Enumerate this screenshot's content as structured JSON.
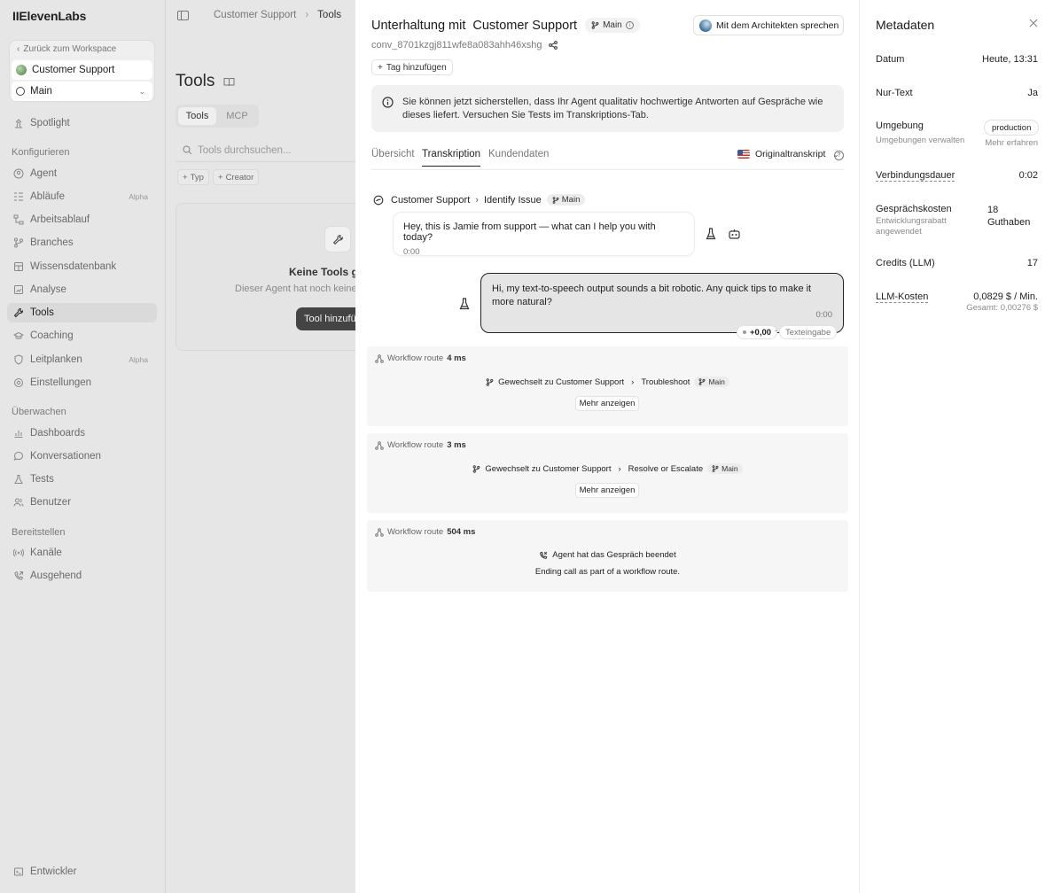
{
  "sidebar": {
    "logo": "IIElevenLabs",
    "back_label": "Zurück zum Workspace",
    "agent_name": "Customer Support",
    "branch": "Main",
    "spotlight": "Spotlight",
    "section_configure": "Konfigurieren",
    "configure_items": [
      {
        "label": "Agent",
        "icon": "agent-icon"
      },
      {
        "label": "Abläufe",
        "icon": "flows-icon",
        "badge": "Alpha"
      },
      {
        "label": "Arbeitsablauf",
        "icon": "workflow-icon"
      },
      {
        "label": "Branches",
        "icon": "branch-icon"
      },
      {
        "label": "Wissensdatenbank",
        "icon": "book-icon"
      },
      {
        "label": "Analyse",
        "icon": "analysis-icon"
      },
      {
        "label": "Tools",
        "icon": "wrench-icon",
        "active": true
      },
      {
        "label": "Coaching",
        "icon": "coaching-icon"
      },
      {
        "label": "Leitplanken",
        "icon": "shield-icon",
        "badge": "Alpha"
      },
      {
        "label": "Einstellungen",
        "icon": "settings-icon"
      }
    ],
    "section_monitor": "Überwachen",
    "monitor_items": [
      {
        "label": "Dashboards",
        "icon": "chart-icon"
      },
      {
        "label": "Konversationen",
        "icon": "chat-icon"
      },
      {
        "label": "Tests",
        "icon": "flask-icon"
      },
      {
        "label": "Benutzer",
        "icon": "users-icon"
      }
    ],
    "section_deploy": "Bereitstellen",
    "deploy_items": [
      {
        "label": "Kanäle",
        "icon": "broadcast-icon"
      },
      {
        "label": "Ausgehend",
        "icon": "phone-outgoing-icon"
      }
    ],
    "developer": "Entwickler"
  },
  "tools_panel": {
    "breadcrumb_parent": "Customer Support",
    "breadcrumb_current": "Tools",
    "title": "Tools",
    "seg_tools": "Tools",
    "seg_mcp": "MCP",
    "search_placeholder": "Tools durchsuchen...",
    "filter_type": "Typ",
    "filter_creator": "Creator",
    "empty_title": "Keine Tools ge",
    "empty_sub": "Dieser Agent hat noch keine",
    "add_tool": "Tool hinzufü"
  },
  "conversation": {
    "title_prefix": "Unterhaltung mit",
    "title_agent": "Customer Support",
    "branch": "Main",
    "architect_button": "Mit dem Architekten sprechen",
    "conv_id": "conv_8701kzgj811wfe8a083ahh46xshg",
    "add_tag": "Tag hinzufügen",
    "banner": "Sie können jetzt sicherstellen, dass Ihr Agent qualitativ hochwertige Antworten auf Gespräche wie dieses liefert. Versuchen Sie Tests im Transkriptions-Tab.",
    "tabs": [
      "Übersicht",
      "Transkription",
      "Kundendaten"
    ],
    "transcript_select": "Originaltranskript",
    "agent_path": "Customer Support",
    "agent_node": "Identify Issue",
    "agent_branch": "Main",
    "agent_message": "Hey, this is Jamie from support — what can I help you with today?",
    "agent_time": "0:00",
    "user_message": "Hi, my text-to-speech output sounds a bit robotic. Any quick tips to make it more natural?",
    "user_time": "0:00",
    "cost_chip": "+0,00",
    "input_chip": "Texteingabe",
    "workflows": [
      {
        "label": "Workflow route",
        "duration": "4 ms",
        "text": "Gewechselt zu Customer Support",
        "node": "Troubleshoot",
        "branch": "Main",
        "more": "Mehr anzeigen"
      },
      {
        "label": "Workflow route",
        "duration": "3 ms",
        "text": "Gewechselt zu Customer Support",
        "node": "Resolve or Escalate",
        "branch": "Main",
        "more": "Mehr anzeigen"
      },
      {
        "label": "Workflow route",
        "duration": "504 ms",
        "text": "Agent hat das Gespräch beendet",
        "sub": "Ending call as part of a workflow route."
      }
    ]
  },
  "metadata": {
    "title": "Metadaten",
    "date_label": "Datum",
    "date_value": "Heute, 13:31",
    "textonly_label": "Nur-Text",
    "textonly_value": "Ja",
    "env_label": "Umgebung",
    "env_sub": "Umgebungen verwalten",
    "env_value": "production",
    "env_link": "Mehr erfahren",
    "duration_label": "Verbindungsdauer",
    "duration_value": "0:02",
    "cost_label": "Gesprächskosten",
    "cost_sub": "Entwicklungsrabatt angewendet",
    "cost_value_1": "18",
    "cost_value_2": "Guthaben",
    "credits_label": "Credits (LLM)",
    "credits_value": "17",
    "llm_label": "LLM-Kosten",
    "llm_value": "0,0829 $ / Min.",
    "llm_total": "Gesamt: 0,00276 $"
  }
}
